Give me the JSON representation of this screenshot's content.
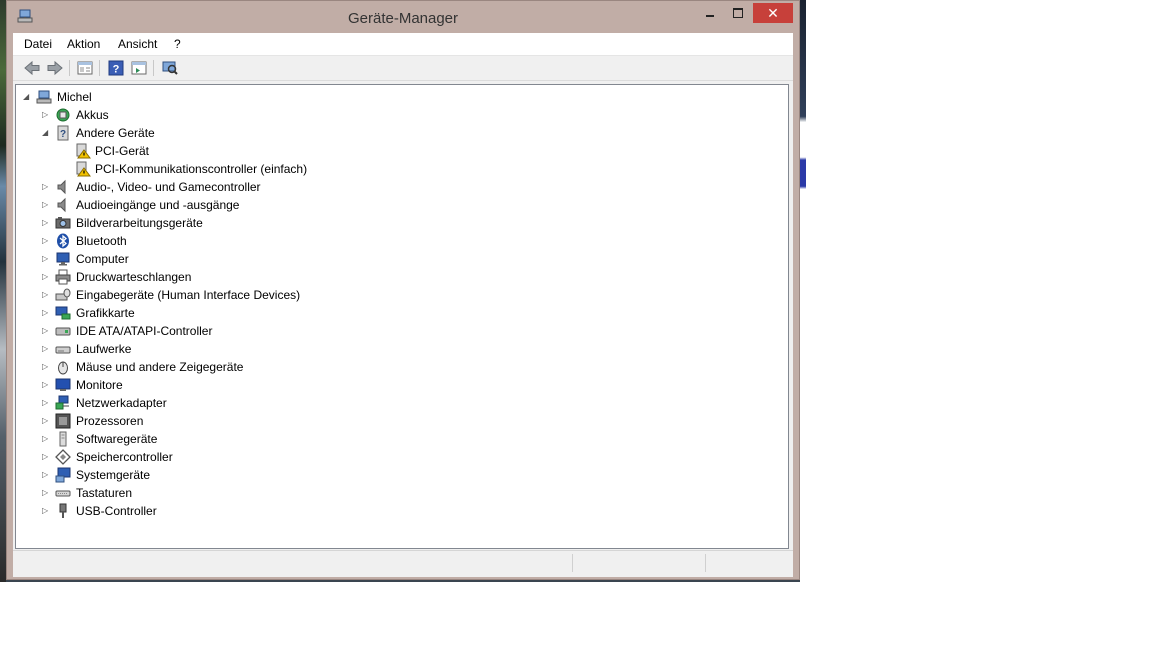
{
  "window": {
    "title": "Geräte-Manager",
    "close_glyph": "✕"
  },
  "menu": {
    "items": [
      {
        "label": "Datei"
      },
      {
        "label": "Aktion"
      },
      {
        "label": "Ansicht"
      },
      {
        "label": "?"
      }
    ]
  },
  "toolbar": {
    "icons": [
      "back-arrow-icon",
      "forward-arrow-icon",
      "properties-icon",
      "help-icon",
      "update-driver-icon",
      "scan-hardware-icon"
    ]
  },
  "tree": {
    "root": {
      "label": "Michel",
      "expanded": true,
      "icon": "computer-icon"
    },
    "categories": [
      {
        "label": "Akkus",
        "expanded": false,
        "icon": "battery-icon"
      },
      {
        "label": "Andere Geräte",
        "expanded": true,
        "icon": "unknown-device-icon",
        "children": [
          {
            "label": "PCI-Gerät",
            "icon": "warning-device-icon"
          },
          {
            "label": "PCI-Kommunikationscontroller (einfach)",
            "icon": "warning-device-icon"
          }
        ]
      },
      {
        "label": "Audio-, Video- und Gamecontroller",
        "expanded": false,
        "icon": "speaker-icon"
      },
      {
        "label": "Audioeingänge und -ausgänge",
        "expanded": false,
        "icon": "speaker-icon"
      },
      {
        "label": "Bildverarbeitungsgeräte",
        "expanded": false,
        "icon": "camera-icon"
      },
      {
        "label": "Bluetooth",
        "expanded": false,
        "icon": "bluetooth-icon"
      },
      {
        "label": "Computer",
        "expanded": false,
        "icon": "monitor-icon"
      },
      {
        "label": "Druckwarteschlangen",
        "expanded": false,
        "icon": "printer-icon"
      },
      {
        "label": "Eingabegeräte (Human Interface Devices)",
        "expanded": false,
        "icon": "hid-icon"
      },
      {
        "label": "Grafikkarte",
        "expanded": false,
        "icon": "display-adapter-icon"
      },
      {
        "label": "IDE ATA/ATAPI-Controller",
        "expanded": false,
        "icon": "ide-controller-icon"
      },
      {
        "label": "Laufwerke",
        "expanded": false,
        "icon": "disk-drive-icon"
      },
      {
        "label": "Mäuse und andere Zeigegeräte",
        "expanded": false,
        "icon": "mouse-icon"
      },
      {
        "label": "Monitore",
        "expanded": false,
        "icon": "monitor-icon"
      },
      {
        "label": "Netzwerkadapter",
        "expanded": false,
        "icon": "network-adapter-icon"
      },
      {
        "label": "Prozessoren",
        "expanded": false,
        "icon": "processor-icon"
      },
      {
        "label": "Softwaregeräte",
        "expanded": false,
        "icon": "software-device-icon"
      },
      {
        "label": "Speichercontroller",
        "expanded": false,
        "icon": "storage-controller-icon"
      },
      {
        "label": "Systemgeräte",
        "expanded": false,
        "icon": "system-device-icon"
      },
      {
        "label": "Tastaturen",
        "expanded": false,
        "icon": "keyboard-icon"
      },
      {
        "label": "USB-Controller",
        "expanded": false,
        "icon": "usb-icon"
      }
    ]
  },
  "colors": {
    "frame": "#c1ada6",
    "close": "#c7403a",
    "warning": "#f2c200"
  }
}
